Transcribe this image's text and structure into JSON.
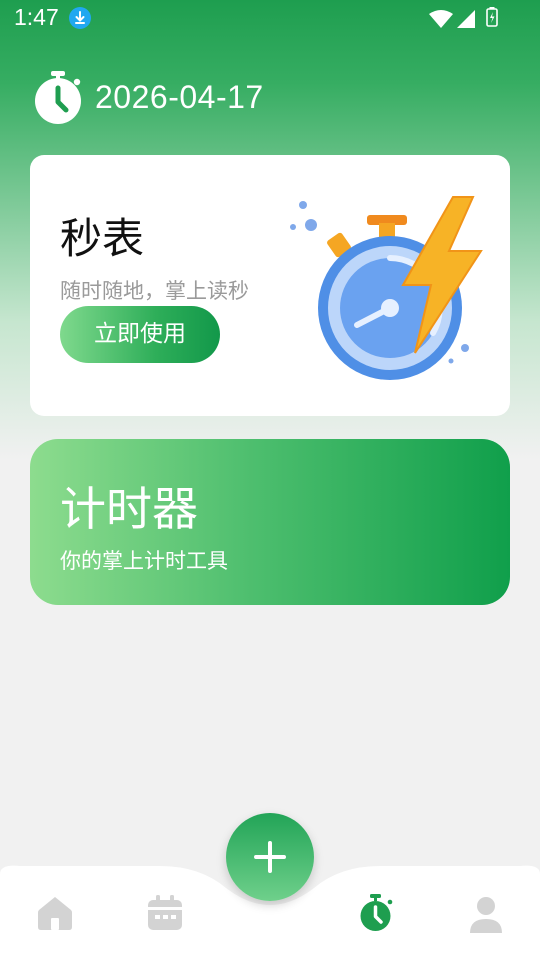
{
  "status_bar": {
    "time": "1:47"
  },
  "header": {
    "date": "2026-04-17"
  },
  "stopwatch_card": {
    "title": "秒表",
    "subtitle": "随时随地，掌上读秒",
    "button_label": "立即使用"
  },
  "timer_card": {
    "title": "计时器",
    "subtitle": "你的掌上计时工具"
  },
  "bottom_nav": {
    "items": [
      {
        "icon": "home-icon",
        "active": false
      },
      {
        "icon": "calendar-icon",
        "active": false
      },
      {
        "icon": "stopwatch-icon",
        "active": true
      },
      {
        "icon": "profile-icon",
        "active": false
      }
    ],
    "fab_icon": "plus-icon"
  },
  "colors": {
    "brand_green": "#1e9e4f",
    "inactive_icon": "#d0d0d0",
    "accent_blue": "#4f8fe6",
    "accent_orange": "#f5a623"
  }
}
